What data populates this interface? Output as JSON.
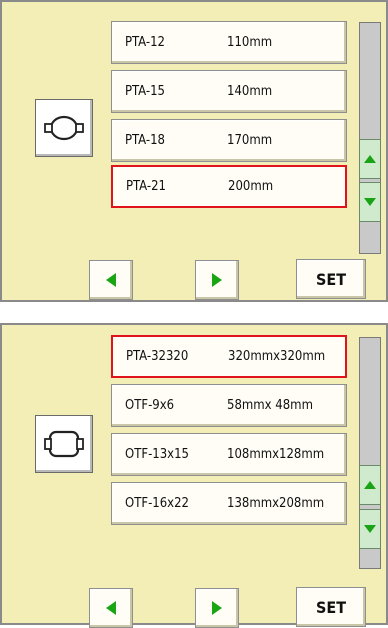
{
  "screen1": {
    "icon": "round-hoop-icon",
    "items": [
      {
        "model": "PTA-12",
        "size": "110mm",
        "selected": false
      },
      {
        "model": "PTA-15",
        "size": "140mm",
        "selected": false
      },
      {
        "model": "PTA-18",
        "size": "170mm",
        "selected": false
      },
      {
        "model": "PTA-21",
        "size": "200mm",
        "selected": true
      }
    ],
    "set_label": "SET"
  },
  "screen2": {
    "icon": "rectangular-hoop-icon",
    "items": [
      {
        "model": "PTA-32320",
        "size": "320mmx320mm",
        "selected": true
      },
      {
        "model": "OTF-9x6",
        "size": "58mmx 48mm",
        "selected": false
      },
      {
        "model": "OTF-13x15",
        "size": "108mmx128mm",
        "selected": false
      },
      {
        "model": "OTF-16x22",
        "size": "138mmx208mm",
        "selected": false
      }
    ],
    "set_label": "SET"
  },
  "colors": {
    "panel_bg": "#f2eeb6",
    "selected_border": "#e0121c",
    "arrow_green": "#19a516"
  }
}
